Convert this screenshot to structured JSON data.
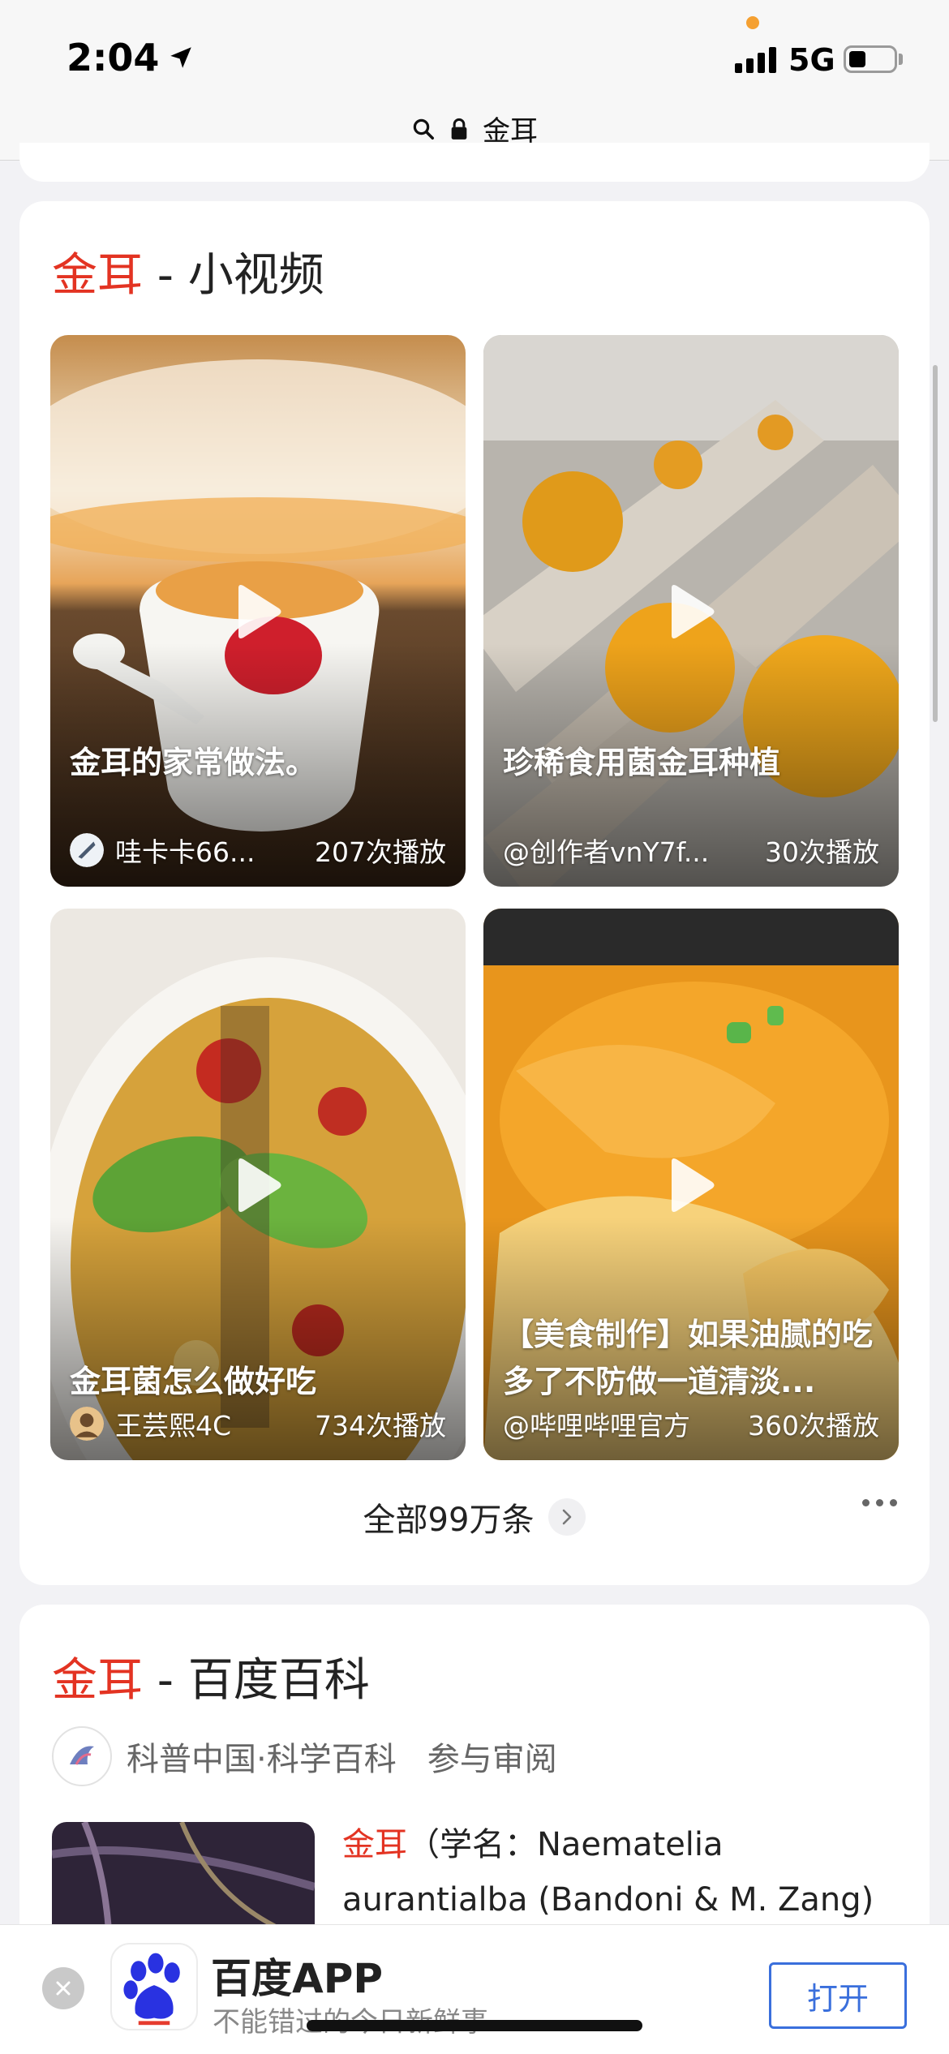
{
  "status_bar": {
    "time": "2:04",
    "network": "5G"
  },
  "url_bar": {
    "query": "金耳"
  },
  "video_section": {
    "title_keyword": "金耳",
    "title_rest": " - 小视频",
    "videos": [
      {
        "title": "金耳的家常做法。",
        "author": "哇卡卡66...",
        "plays": "207次播放"
      },
      {
        "title": "珍稀食用菌金耳种植",
        "author": "@创作者vnY7f...",
        "plays": "30次播放"
      },
      {
        "title": "金耳菌怎么做好吃",
        "author": "王芸熙4C",
        "plays": "734次播放"
      },
      {
        "title": "【美食制作】如果油腻的吃多了不防做一道清淡...",
        "author": "@哔哩哔哩官方",
        "plays": "360次播放"
      }
    ],
    "see_all": "全部99万条"
  },
  "baike_section": {
    "title_keyword": "金耳",
    "title_rest": " - 百度百科",
    "source": "科普中国·科学百科",
    "review": "参与审阅",
    "snippet_keyword": "金耳",
    "snippet_rest": "（学名：Naematelia aurantialba (Bandoni & M. Zang) Millanes &"
  },
  "app_banner": {
    "name": "百度APP",
    "subtitle": "不能错过的今日新鲜事",
    "open_label": "打开"
  },
  "colors": {
    "keyword_red": "#e33322",
    "open_blue": "#3a6fdc",
    "baidu_blue": "#2932e1"
  }
}
